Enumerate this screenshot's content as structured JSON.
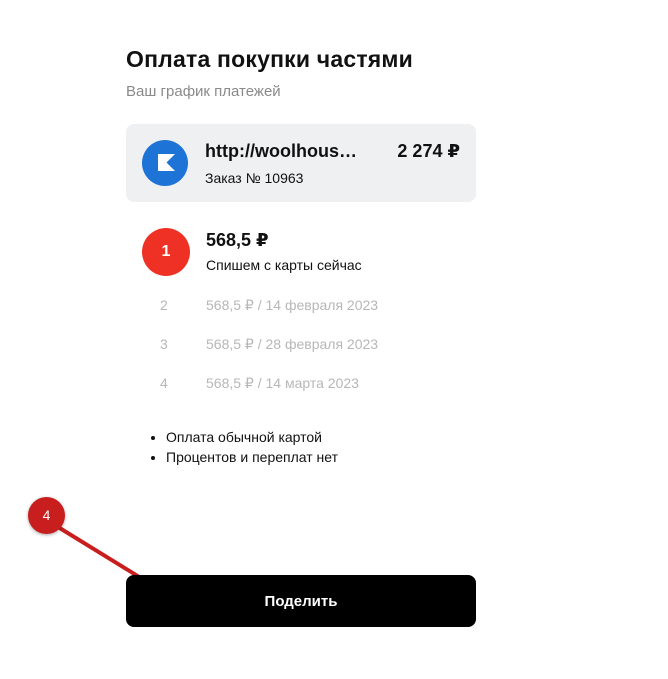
{
  "header": {
    "title": "Оплата покупки частями",
    "subtitle": "Ваш график платежей"
  },
  "order": {
    "merchant_url": "http://woolhous…",
    "total": "2 274 ₽",
    "order_number": "Заказ № 10963",
    "logo_color": "#1e73d6"
  },
  "first_payment": {
    "badge": "1",
    "amount": "568,5 ₽",
    "note": "Спишем с карты сейчас",
    "badge_color": "#ee3124"
  },
  "installments": [
    {
      "num": "2",
      "text": "568,5 ₽ / 14 февраля 2023"
    },
    {
      "num": "3",
      "text": "568,5 ₽ / 28 февраля 2023"
    },
    {
      "num": "4",
      "text": "568,5 ₽ / 14 марта 2023"
    }
  ],
  "features": [
    "Оплата обычной картой",
    "Процентов и переплат нет"
  ],
  "annotation": {
    "label": "4",
    "color": "#c81e1e"
  },
  "action": {
    "label": "Поделить"
  }
}
